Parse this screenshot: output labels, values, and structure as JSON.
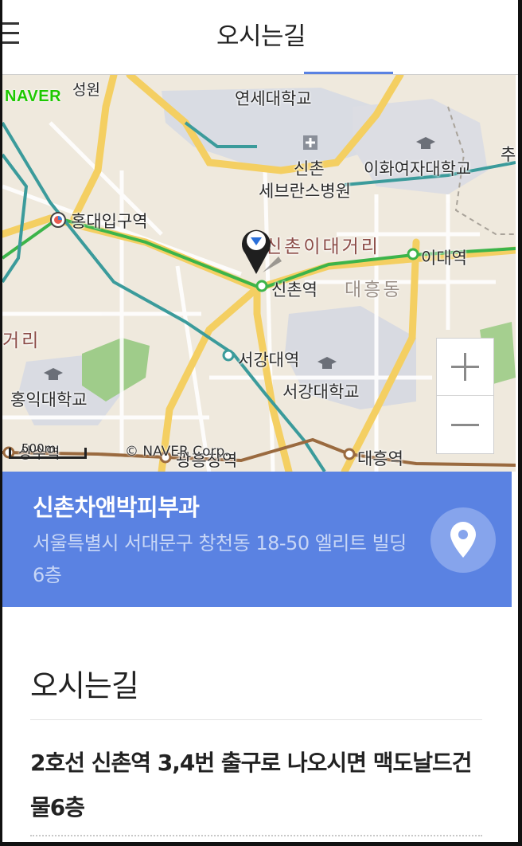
{
  "header": {
    "title": "오시는길"
  },
  "map": {
    "provider_logo": "NAVER",
    "copyright": "© NAVER Corp.",
    "scale_label": "500m",
    "labels": {
      "yonsei": "연세대학교",
      "severance_1": "신촌",
      "severance_2": "세브란스병원",
      "ewha": "이화여자대학교",
      "hongik_station": "홍대입구역",
      "sinchon_ewha_street": "신촌이대거리",
      "ewha_station": "이대역",
      "sinchon_station": "신촌역",
      "daeheung_dong": "대흥동",
      "seogang_station": "서강대역",
      "sogang_univ": "서강대학교",
      "hongik_univ": "홍익대학교",
      "gwangheungchang": "광흥창역",
      "daeheung_station": "대흥역",
      "sangsu_station": "상수역",
      "edge_left": "거리",
      "top_edge": "성원",
      "right_edge": "추"
    },
    "icons": {
      "pin": "map-pin-icon",
      "zoom_in": "plus-icon",
      "zoom_out": "minus-icon"
    }
  },
  "place": {
    "name": "신촌차앤박피부과",
    "address": "서울특별시 서대문구 창천동 18-50 엘리트 빌딩 6층",
    "location_icon": "location-marker-icon"
  },
  "section": {
    "title": "오시는길",
    "directions": "2호선 신촌역 3,4번 출구로 나오시면 맥도날드건물6층"
  },
  "colors": {
    "accent_blue": "#5a82e2",
    "line2_green": "#3cb44a",
    "gyeongui_teal": "#3b9b9b",
    "line6_brown": "#9a6a3f",
    "arterial_yellow": "#f6d46a"
  }
}
